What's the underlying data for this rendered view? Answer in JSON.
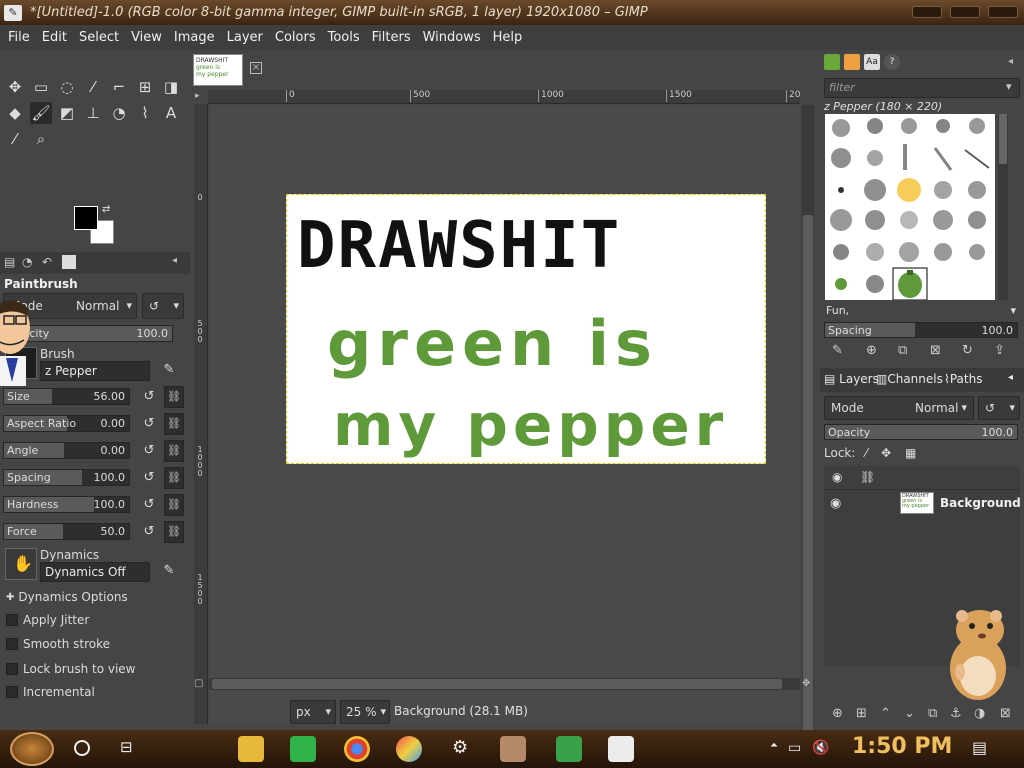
{
  "window": {
    "title": "*[Untitled]-1.0 (RGB color 8-bit gamma integer, GIMP built-in sRGB, 1 layer) 1920x1080 – GIMP",
    "icon": "gimp-app-icon"
  },
  "menu": [
    "File",
    "Edit",
    "Select",
    "View",
    "Image",
    "Layer",
    "Colors",
    "Tools",
    "Filters",
    "Windows",
    "Help"
  ],
  "colors": {
    "foreground": "#000000",
    "background": "#ffffff",
    "titlebar": "#5a3a1e",
    "pepper_green": "#5f9a3a",
    "clock": "#f0c060"
  },
  "tool_options": {
    "title": "Paintbrush",
    "mode_label": "Mode",
    "mode_value": "Normal",
    "opacity_label": "Opacity",
    "opacity_value": "100.0",
    "brush_label": "Brush",
    "brush_value": "z Pepper",
    "size_label": "Size",
    "size_value": "56.00",
    "aspect_label": "Aspect Ratio",
    "aspect_value": "0.00",
    "angle_label": "Angle",
    "angle_value": "0.00",
    "spacing_label": "Spacing",
    "spacing_value": "100.0",
    "hardness_label": "Hardness",
    "hardness_value": "100.0",
    "force_label": "Force",
    "force_value": "50.0",
    "dynamics_label": "Dynamics",
    "dynamics_value": "Dynamics Off",
    "dynamics_options": "Dynamics Options",
    "checkboxes": [
      "Apply Jitter",
      "Smooth stroke",
      "Lock brush to view",
      "Incremental"
    ]
  },
  "image_tab": {
    "thumb_line1": "DRAWSHIT",
    "thumb_line2": "green is",
    "thumb_line3": "my pepper"
  },
  "canvas": {
    "ruler_h": [
      "0",
      "500",
      "1000",
      "1500",
      "20"
    ],
    "ruler_v": [
      "0",
      "5\n0\n0",
      "1\n0\n0\n0",
      "1\n5\n0\n0"
    ],
    "text_line1": "DRAWSHIT",
    "text_line2": "green is",
    "text_line3": "my pepper"
  },
  "statusbar": {
    "unit": "px",
    "zoom": "25 %",
    "info": "Background (28.1 MB)"
  },
  "brushes": {
    "filter_placeholder": "filter",
    "selected_name": "z Pepper (180 × 220)",
    "tag": "Fun,",
    "spacing_label": "Spacing",
    "spacing_value": "100.0"
  },
  "layers": {
    "tabs": [
      "Layers",
      "Channels",
      "Paths"
    ],
    "mode_label": "Mode",
    "mode_value": "Normal",
    "opacity_label": "Opacity",
    "opacity_value": "100.0",
    "lock_label": "Lock:",
    "layer_name": "Background"
  },
  "taskbar": {
    "clock": "1:50 PM"
  }
}
